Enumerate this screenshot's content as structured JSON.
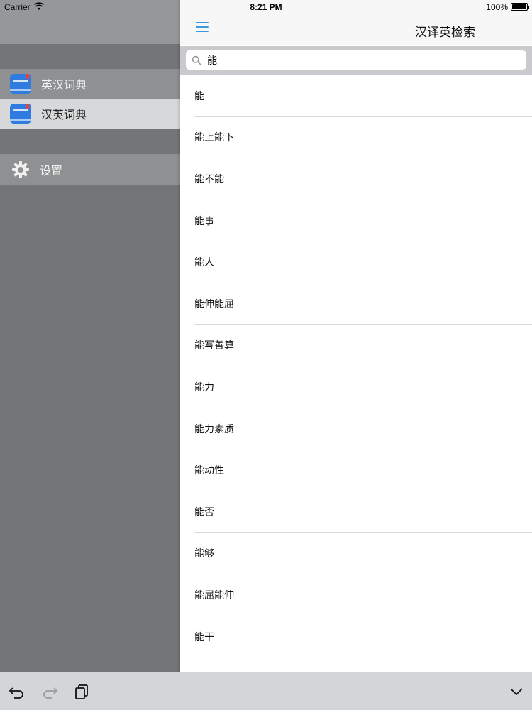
{
  "status_bar": {
    "carrier": "Carrier",
    "time": "8:21 PM",
    "battery": "100%"
  },
  "sidebar": {
    "items": [
      {
        "label": "英汉词典",
        "icon": "dictionary-book-icon"
      },
      {
        "label": "汉英词典",
        "icon": "dictionary-book-icon",
        "selected": true
      },
      {
        "label": "设置",
        "icon": "gear-icon"
      }
    ]
  },
  "navbar": {
    "title": "汉译英检索",
    "menu_icon": "hamburger-icon"
  },
  "search": {
    "value": "能",
    "icon": "search-icon"
  },
  "results": [
    "能",
    "能上能下",
    "能不能",
    "能事",
    "能人",
    "能伸能屈",
    "能写善算",
    "能力",
    "能力素质",
    "能动性",
    "能否",
    "能够",
    "能屈能伸",
    "能干"
  ],
  "toolbar": {
    "undo_icon": "undo-icon",
    "redo_icon": "redo-icon",
    "paste_icon": "paste-icon",
    "hide_keyboard_icon": "chevron-down-icon"
  },
  "colors": {
    "accent": "#3a9bdc",
    "sidebar_bg": "#737576",
    "selected_item_bg": "#d7d8d9"
  }
}
